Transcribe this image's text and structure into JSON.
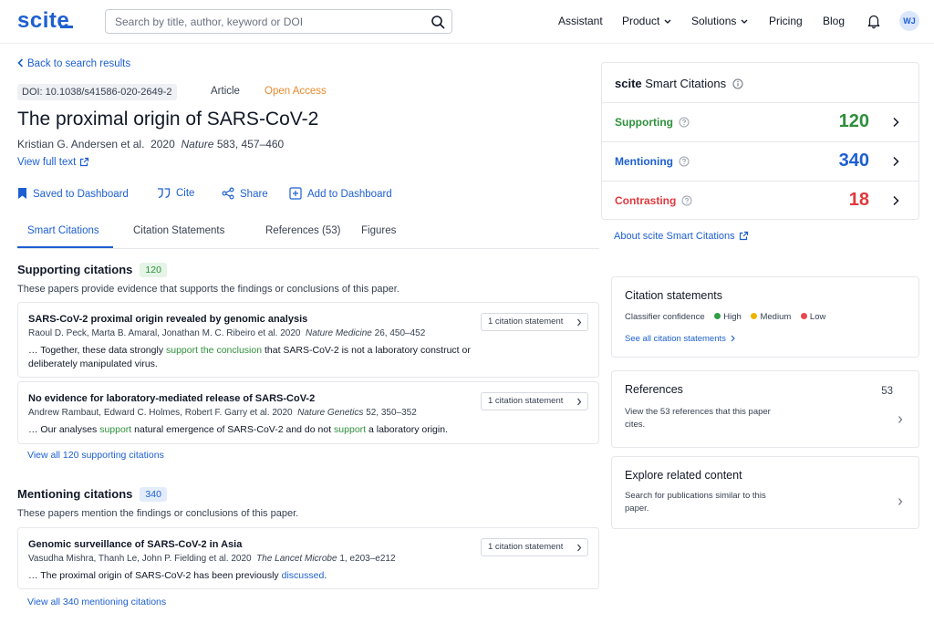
{
  "header": {
    "logo": "scite",
    "search_placeholder": "Search by title, author, keyword or DOI",
    "nav": [
      "Assistant",
      "Product",
      "Solutions",
      "Pricing",
      "Blog"
    ],
    "avatar": "WJ"
  },
  "article": {
    "back_link": "Back to search results",
    "doi": "DOI: 10.1038/s41586-020-2649-2",
    "type": "Article",
    "access": "Open Access",
    "title": "The proximal origin of SARS-CoV-2",
    "authors": "Kristian G. Andersen et al.",
    "year": "2020",
    "journal": "Nature",
    "volume_pages": "583, 457–460",
    "full_text_link": "View full text"
  },
  "actions": [
    "Saved to Dashboard",
    "Cite",
    "Share",
    "Add to Dashboard"
  ],
  "tabs": [
    "Smart Citations",
    "Citation Statements",
    "References (53)",
    "Figures"
  ],
  "supporting": {
    "heading": "Supporting citations",
    "count": "120",
    "description": "These papers provide evidence that supports the findings or conclusions of this paper.",
    "view_all": "View all 120 supporting citations",
    "cards": [
      {
        "title": "SARS-CoV-2 proximal origin revealed by genomic analysis",
        "authors": "Raoul D. Peck, Marta B. Amaral, Jonathan M. C. Ribeiro et al. 2020",
        "journal": "Nature Medicine",
        "volume": "26, 450–452",
        "text_pre": "… Together, these data strongly ",
        "text_hl": "support the conclusion",
        "text_post": " that SARS-CoV-2 is not a laboratory construct or",
        "text_line2": "deliberately manipulated virus.",
        "button": "1 citation statement"
      },
      {
        "title": "No evidence for laboratory-mediated release of SARS-CoV-2",
        "authors": "Andrew Rambaut, Edward C. Holmes, Robert F. Garry et al. 2020",
        "journal": "Nature Genetics",
        "volume": "52, 350–352",
        "text_pre": "… Our analyses ",
        "text_hl": "support",
        "text_mid": " natural emergence of SARS-CoV-2 and do not ",
        "text_hl2": "support",
        "text_post": " a laboratory origin.",
        "button": "1 citation statement"
      }
    ]
  },
  "mentioning": {
    "heading": "Mentioning citations",
    "count": "340",
    "description": "These papers mention the findings or conclusions of this paper.",
    "view_all": "View all 340 mentioning citations",
    "cards": [
      {
        "title": "Genomic surveillance of SARS-CoV-2 in Asia",
        "authors": "Vasudha Mishra, Thanh Le, John P. Fielding et al. 2020",
        "journal": "The Lancet Microbe",
        "volume": "1, e203–e212",
        "text_pre": "… The proximal origin of SARS-CoV-2 has been previously ",
        "text_hl": "discussed",
        "text_post": ".",
        "button": "1 citation statement"
      }
    ]
  },
  "smart_citations": {
    "brand": "scite",
    "title": "Smart Citations",
    "rows": [
      {
        "label": "Supporting",
        "value": "120",
        "color": "#2f8f3c"
      },
      {
        "label": "Mentioning",
        "value": "340",
        "color": "#1d5fd1"
      },
      {
        "label": "Contrasting",
        "value": "18",
        "color": "#e0393e"
      }
    ],
    "about_link": "About scite Smart Citations"
  },
  "citation_statements": {
    "title": "Citation statements",
    "classifier_label": "Classifier confidence",
    "levels": [
      {
        "label": "High",
        "color": "#2f9e44"
      },
      {
        "label": "Medium",
        "color": "#f0b400"
      },
      {
        "label": "Low",
        "color": "#e5484d"
      }
    ],
    "see_all": "See all citation statements"
  },
  "references": {
    "title": "References",
    "count": "53",
    "text": "View the 53 references that this paper cites."
  },
  "related": {
    "title": "Explore related content",
    "text": "Search for publications similar to this paper."
  }
}
